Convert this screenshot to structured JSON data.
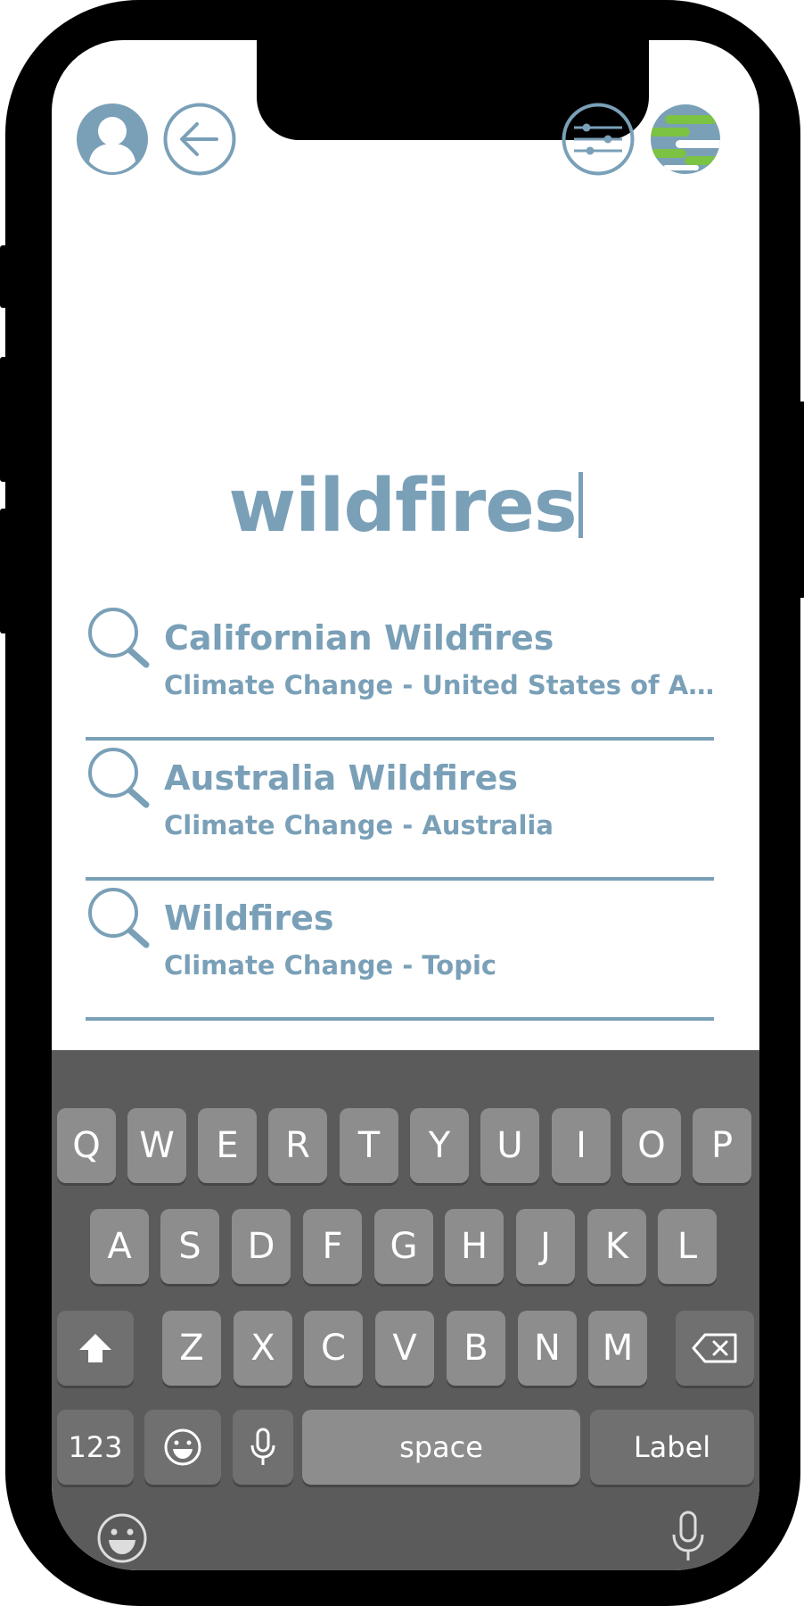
{
  "search": {
    "query": "wildfires"
  },
  "results": [
    {
      "title": "Californian Wildfires",
      "subtitle": "Climate Change - United States of America"
    },
    {
      "title": "Australia Wildfires",
      "subtitle": "Climate Change - Australia"
    },
    {
      "title": "Wildfires",
      "subtitle": "Climate Change - Topic"
    }
  ],
  "keyboard": {
    "row1": [
      "Q",
      "W",
      "E",
      "R",
      "T",
      "Y",
      "U",
      "I",
      "O",
      "P"
    ],
    "row2": [
      "A",
      "S",
      "D",
      "F",
      "G",
      "H",
      "J",
      "K",
      "L"
    ],
    "row3": [
      "Z",
      "X",
      "C",
      "V",
      "B",
      "N",
      "M"
    ],
    "numbers_label": "123",
    "space_label": "space",
    "return_label": "Label"
  },
  "colors": {
    "accent": "#7aa0b8",
    "keyboard_bg": "#5b5b5b",
    "key_bg": "#8d8d8d",
    "logo_green": "#7cc243"
  },
  "icons": [
    "profile-icon",
    "back-arrow-icon",
    "filter-sliders-icon",
    "app-logo-globe-icon",
    "search-icon",
    "shift-icon",
    "backspace-icon",
    "emoji-icon",
    "microphone-icon"
  ]
}
